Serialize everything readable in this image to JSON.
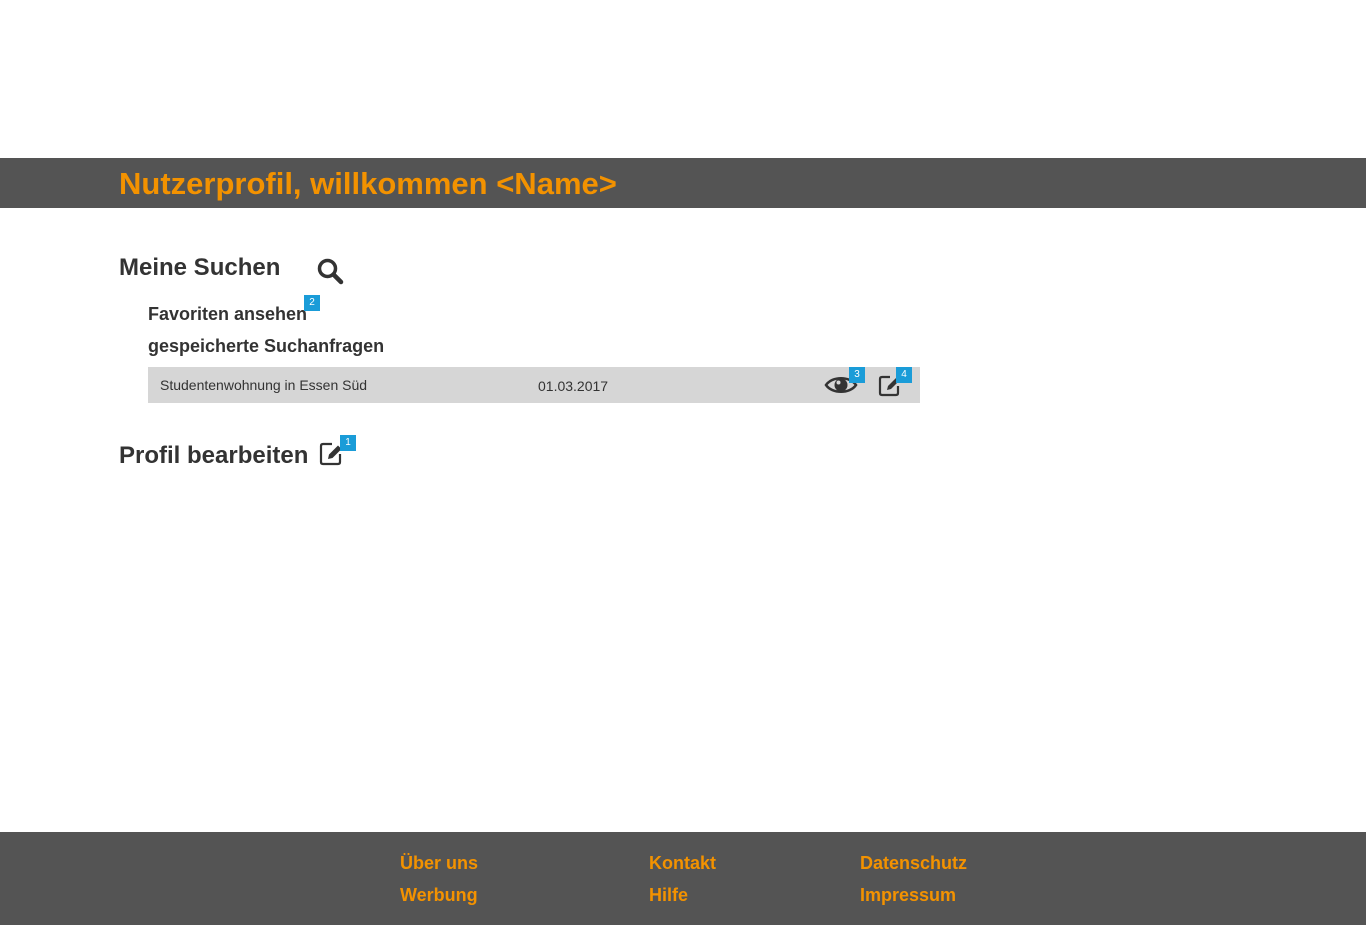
{
  "header": {
    "title": "Nutzerprofil, willkommen <Name>"
  },
  "searches": {
    "title": "Meine Suchen",
    "icon": "search-icon",
    "favorites_label": "Favoriten ansehen",
    "favorites_badge": "2",
    "saved_queries_label": "gespeicherte Suchanfragen",
    "saved_rows": [
      {
        "name": "Studentenwohnung in Essen Süd",
        "date": "01.03.2017",
        "view_icon": "eye-icon",
        "view_badge": "3",
        "edit_icon": "edit-icon",
        "edit_badge": "4"
      }
    ]
  },
  "profile": {
    "title": "Profil bearbeiten",
    "edit_icon": "edit-icon",
    "edit_badge": "1"
  },
  "footer": {
    "links": [
      "Über uns",
      "Werbung",
      "Kontakt",
      "Hilfe",
      "Datenschutz",
      "Impressum"
    ]
  },
  "colors": {
    "accent": "#f39200",
    "bar": "#545454",
    "badge": "#1a9cd8",
    "row": "#d6d6d6",
    "text": "#333333"
  }
}
